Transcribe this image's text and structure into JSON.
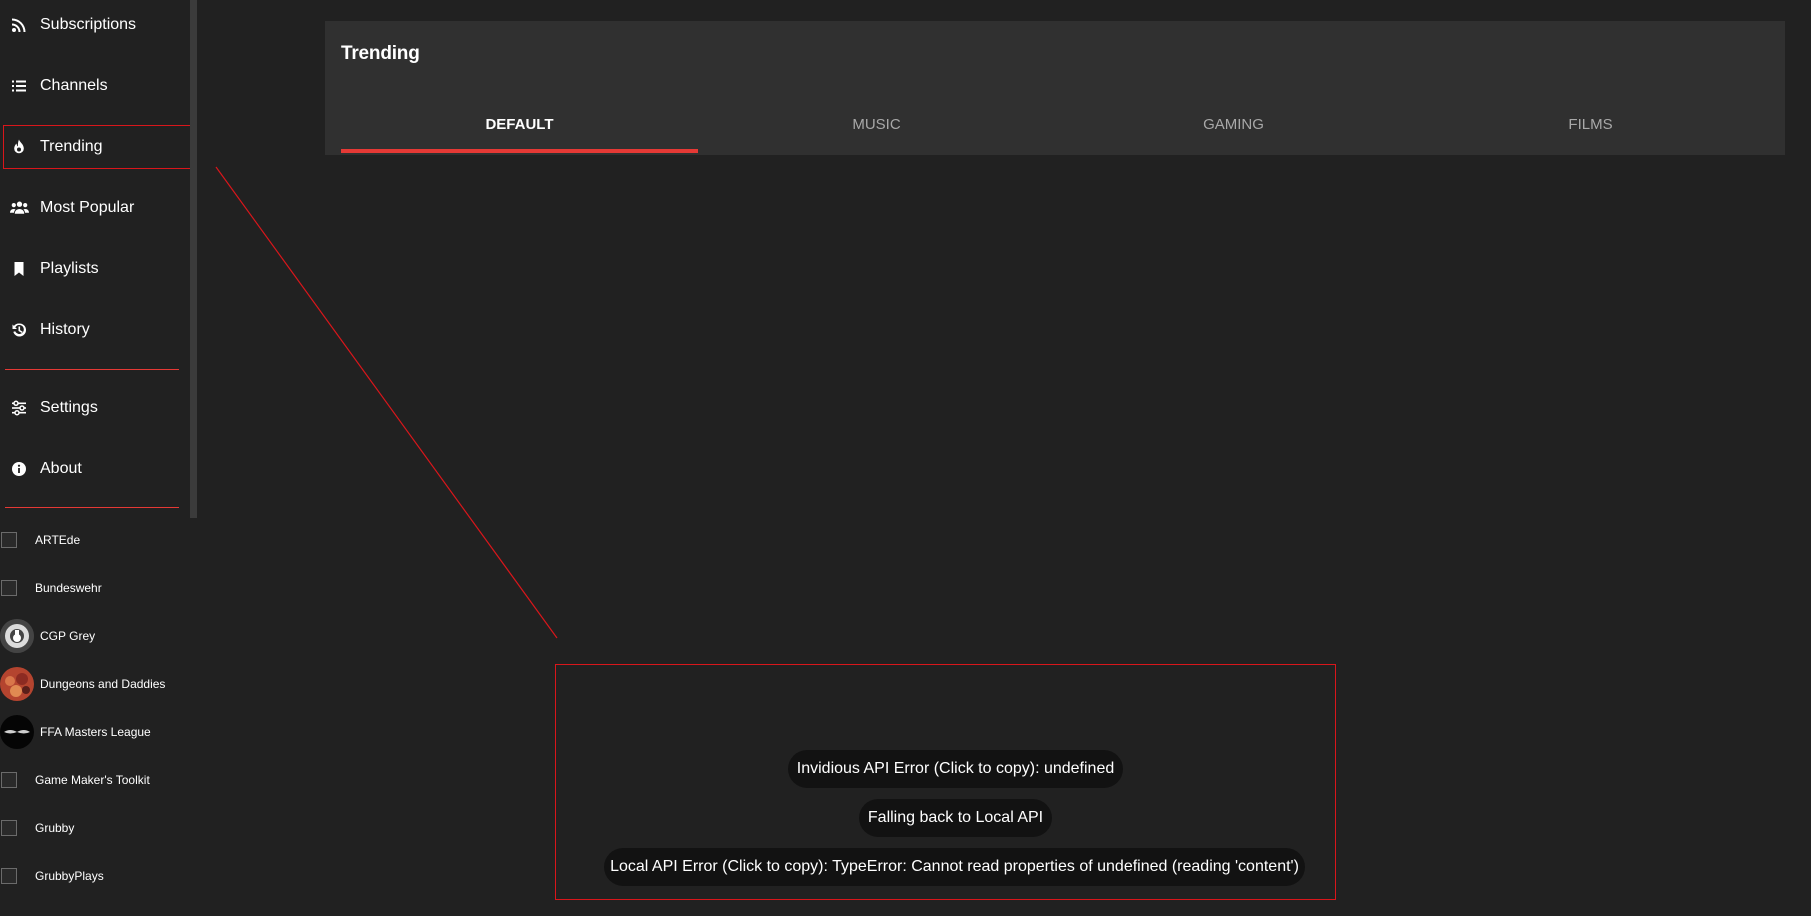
{
  "sidebar": {
    "nav": [
      {
        "label": "Subscriptions",
        "icon": "rss-icon"
      },
      {
        "label": "Channels",
        "icon": "list-icon"
      },
      {
        "label": "Trending",
        "icon": "fire-icon"
      },
      {
        "label": "Most Popular",
        "icon": "users-icon"
      },
      {
        "label": "Playlists",
        "icon": "bookmark-icon"
      },
      {
        "label": "History",
        "icon": "history-icon"
      }
    ],
    "secondary": [
      {
        "label": "Settings",
        "icon": "sliders-icon"
      },
      {
        "label": "About",
        "icon": "info-icon"
      }
    ],
    "channels": [
      {
        "name": "ARTEde"
      },
      {
        "name": "Bundeswehr"
      },
      {
        "name": "CGP Grey"
      },
      {
        "name": "Dungeons and Daddies"
      },
      {
        "name": "FFA Masters League"
      },
      {
        "name": "Game Maker's Toolkit"
      },
      {
        "name": "Grubby"
      },
      {
        "name": "GrubbyPlays"
      }
    ]
  },
  "main": {
    "title": "Trending",
    "tabs": [
      {
        "label": "DEFAULT",
        "active": true
      },
      {
        "label": "MUSIC",
        "active": false
      },
      {
        "label": "GAMING",
        "active": false
      },
      {
        "label": "FILMS",
        "active": false
      }
    ]
  },
  "toasts": [
    {
      "text": "Invidious API Error (Click to copy): undefined"
    },
    {
      "text": "Falling back to Local API"
    },
    {
      "text": "Local API Error (Click to copy): TypeError: Cannot read properties of undefined (reading 'content')"
    }
  ],
  "colors": {
    "background": "#212121",
    "card": "#303030",
    "accent": "#e53935",
    "annotation": "#d9161b",
    "toast": "#121212"
  }
}
